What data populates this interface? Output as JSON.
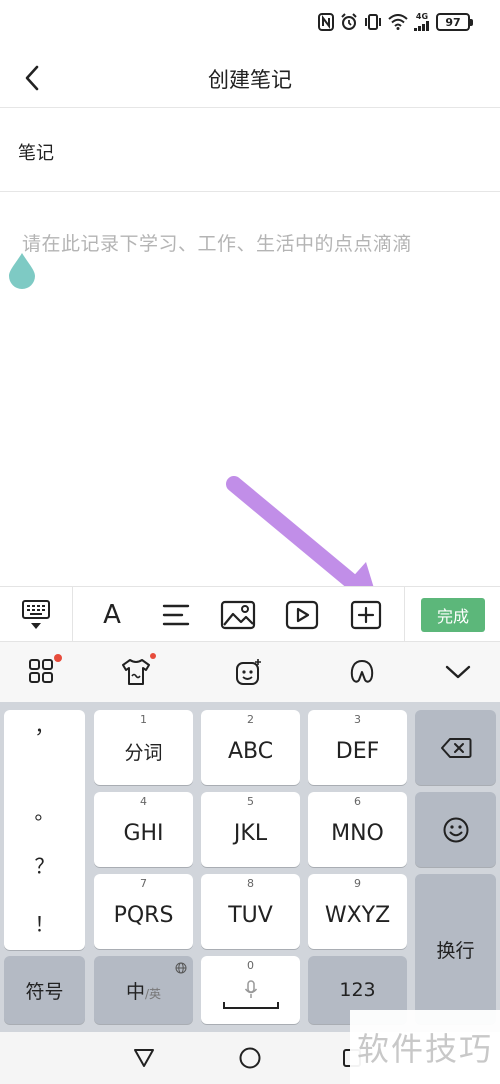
{
  "status": {
    "battery": "97",
    "network": "4G"
  },
  "header": {
    "title": "创建笔记"
  },
  "note": {
    "title": "笔记",
    "placeholder": "请在此记录下学习、工作、生活中的点点滴滴"
  },
  "toolbar": {
    "font_label": "A",
    "done_label": "完成"
  },
  "keyboard": {
    "punctuation": [
      "，",
      "。",
      "？",
      "！"
    ],
    "keys": [
      {
        "num": "1",
        "label": "分词"
      },
      {
        "num": "2",
        "label": "ABC"
      },
      {
        "num": "3",
        "label": "DEF"
      },
      {
        "num": "4",
        "label": "GHI"
      },
      {
        "num": "5",
        "label": "JKL"
      },
      {
        "num": "6",
        "label": "MNO"
      },
      {
        "num": "7",
        "label": "PQRS"
      },
      {
        "num": "8",
        "label": "TUV"
      },
      {
        "num": "9",
        "label": "WXYZ"
      }
    ],
    "symbols_label": "符号",
    "zhong_label": "中",
    "ying_label": "/英",
    "space_num": "0",
    "num_mode_label": "123",
    "enter_label": "换行"
  },
  "watermark": "软件技巧",
  "colors": {
    "accent": "#5cb77a",
    "arrow": "#c18ee8",
    "drop": "#7ecac4"
  }
}
